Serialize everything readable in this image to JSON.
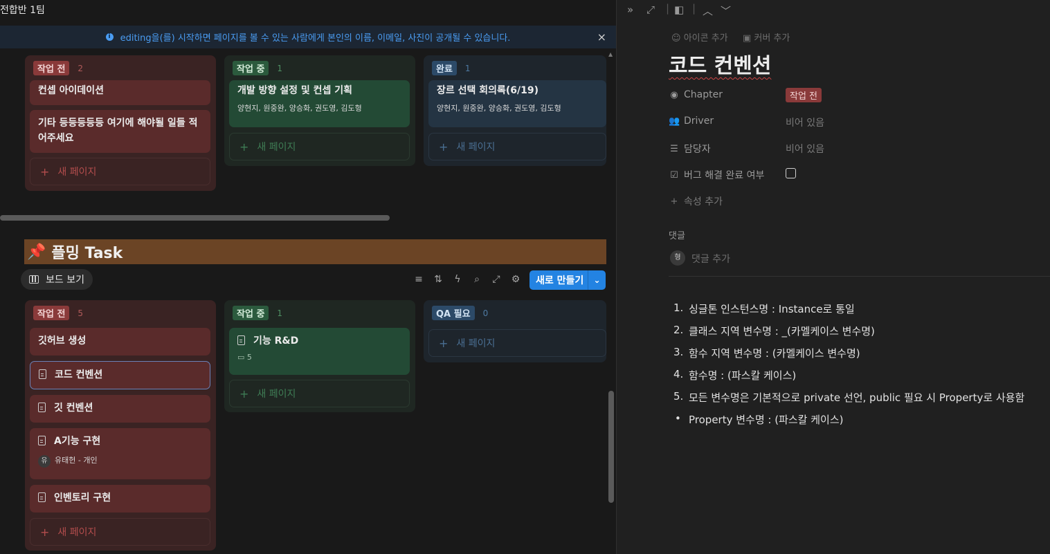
{
  "workspace": {
    "title": "전합반 1팀"
  },
  "banner": {
    "text": "editing을(를) 시작하면 페이지를 볼 수 있는 사람에게 본인의 이름, 이메일, 사진이 공개될 수 있습니다.",
    "close": "×"
  },
  "board1": {
    "columns": [
      {
        "status": "작업 전",
        "count": "2",
        "cards": [
          {
            "title": "컨셉 아이데이션"
          },
          {
            "title": "기타 등등등등등 여기에 해야될 일들 적어주세요"
          }
        ],
        "new_page": "새 페이지"
      },
      {
        "status": "작업 중",
        "count": "1",
        "cards": [
          {
            "title": "개발 방향 설정 및 컨셉 기획",
            "people": "양현지, 원중완, 양승화, 권도영, 김도형"
          }
        ],
        "new_page": "새 페이지"
      },
      {
        "status": "완료",
        "count": "1",
        "cards": [
          {
            "title": "장르 선택 회의록(6/19)",
            "people": "양현지, 원중완, 양승화, 권도영, 김도형"
          }
        ],
        "new_page": "새 페이지"
      }
    ]
  },
  "section": {
    "pin": "📌",
    "title": "플밍 Task"
  },
  "view": {
    "label": "보드 보기"
  },
  "toolbar": {
    "new_label": "새로 만들기",
    "icons": [
      "filter-icon",
      "sort-icon",
      "automation-icon",
      "search-icon",
      "expand-icon",
      "settings-icon"
    ]
  },
  "board2": {
    "columns": [
      {
        "status": "작업 전",
        "count": "5",
        "cards": [
          {
            "title": "깃허브 생성"
          },
          {
            "title": "코드 컨벤션"
          },
          {
            "title": "깃 컨벤션"
          },
          {
            "title": "A기능 구현",
            "person_initial": "유",
            "person": "유태헌 - 개인"
          },
          {
            "title": "인벤토리 구현"
          }
        ],
        "new_page": "새 페이지"
      },
      {
        "status": "작업 중",
        "count": "1",
        "cards": [
          {
            "title": "기능 R&D",
            "comments": "5"
          }
        ],
        "new_page": "새 페이지"
      },
      {
        "status": "QA 필요",
        "count": "0",
        "cards": [],
        "new_page": "새 페이지"
      }
    ]
  },
  "page": {
    "add_icon": "아이콘 추가",
    "add_cover": "커버 추가",
    "title": "코드 컨벤션",
    "props": [
      {
        "name": "Chapter",
        "value": "작업 전"
      },
      {
        "name": "Driver",
        "value": "비어 있음"
      },
      {
        "name": "담당자",
        "value": "비어 있음"
      },
      {
        "name": "버그 해결 완료 여부",
        "value": ""
      }
    ],
    "add_prop": "속성 추가",
    "comments_label": "댓글",
    "comment_avatar": "형",
    "comment_placeholder": "댓글 추가",
    "list": [
      {
        "marker": "1.",
        "text": "싱글톤 인스턴스명 : Instance로 통일"
      },
      {
        "marker": "2.",
        "text": "클래스 지역 변수명 : _(카멜케이스 변수명)"
      },
      {
        "marker": "3.",
        "text": "함수 지역 변수명 : (카멜케이스 변수명)"
      },
      {
        "marker": "4.",
        "text": "함수명 : (파스칼 케이스)"
      },
      {
        "marker": "5.",
        "text": "모든 변수명은 기본적으로 private 선언, public 필요 시 Property로 사용함"
      },
      {
        "marker": "•",
        "text": "Property 변수명 : (파스칼 케이스)"
      }
    ]
  }
}
